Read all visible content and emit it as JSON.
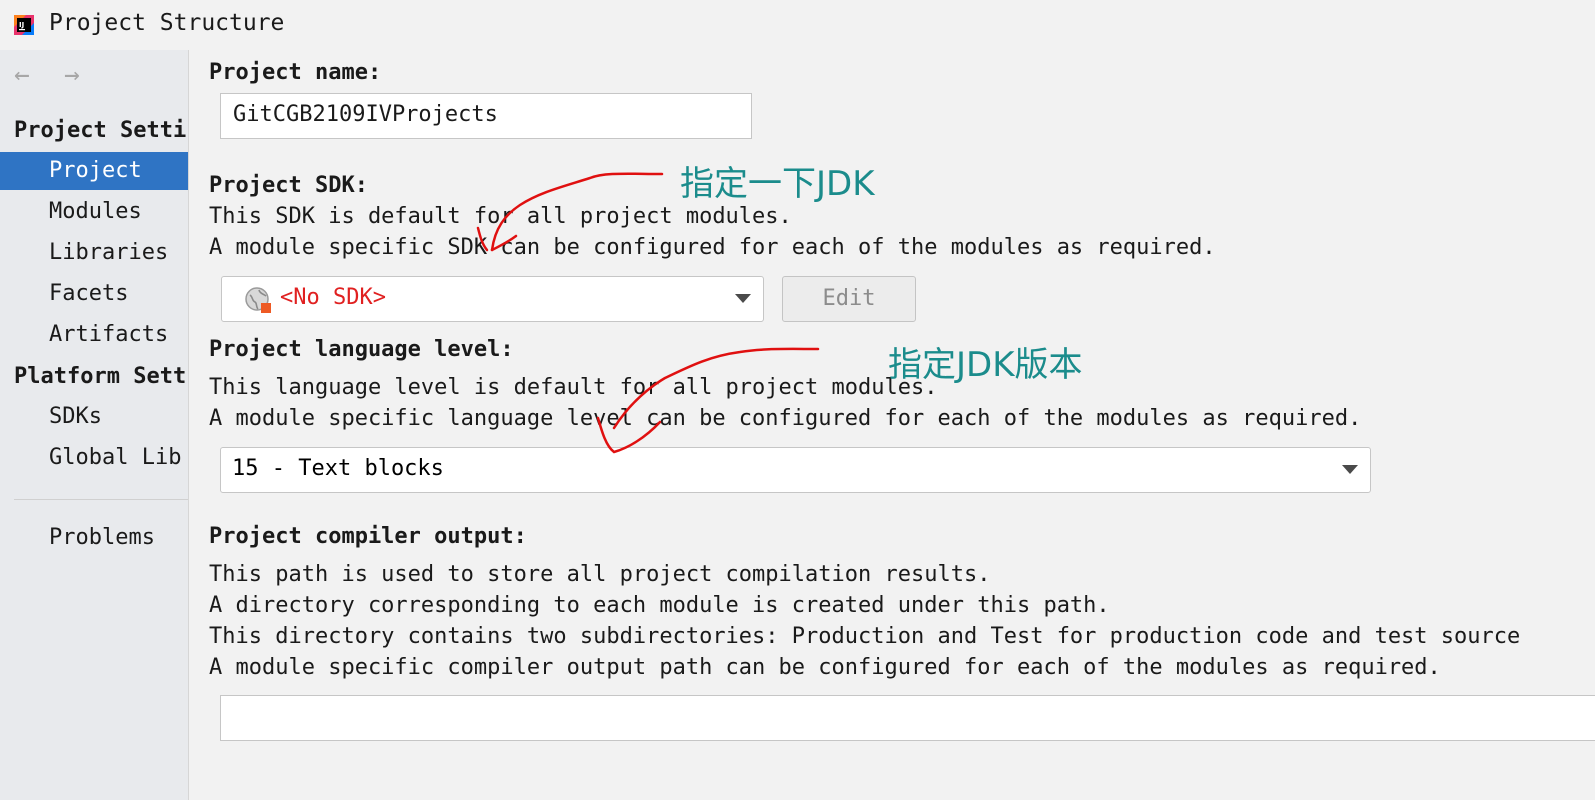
{
  "window": {
    "title": "Project Structure",
    "app_icon": "intellij-icon"
  },
  "sidebar": {
    "nav": {
      "back_icon": "arrow-left-icon",
      "back_glyph": "←",
      "forward_icon": "arrow-right-icon",
      "forward_glyph": "→"
    },
    "sections": [
      {
        "title": "Project Setti"
      },
      {
        "title": "Platform Sett"
      }
    ],
    "project_items": [
      {
        "label": "Project",
        "selected": true
      },
      {
        "label": "Modules"
      },
      {
        "label": "Libraries"
      },
      {
        "label": "Facets"
      },
      {
        "label": "Artifacts"
      }
    ],
    "platform_items": [
      {
        "label": "SDKs"
      },
      {
        "label": "Global Lib"
      }
    ],
    "problems": {
      "label": "Problems"
    }
  },
  "main": {
    "project_name": {
      "label": "Project name:",
      "value": "GitCGB2109IVProjects"
    },
    "project_sdk": {
      "label": "Project SDK:",
      "desc_line1": "This SDK is default for all project modules.",
      "desc_line2": "A module specific SDK can be configured for each of the modules as required.",
      "selected": "<No SDK>",
      "edit_button": "Edit"
    },
    "language_level": {
      "label": "Project language level:",
      "desc_line1": "This language level is default for all project modules.",
      "desc_line2": "A module specific language level can be configured for each of the modules as required.",
      "selected": "15 - Text blocks"
    },
    "compiler_output": {
      "label": "Project compiler output:",
      "desc_line1": "This path is used to store all project compilation results.",
      "desc_line2": "A directory corresponding to each module is created under this path.",
      "desc_line3": "This directory contains two subdirectories: Production and Test for production code and test source",
      "desc_line4": "A module specific compiler output path can be configured for each of the modules as required.",
      "value": ""
    }
  },
  "annotations": {
    "sdk_note": "指定一下JDK",
    "level_note": "指定JDK版本",
    "color": "#1b8c8c",
    "stroke_color": "#e01010"
  },
  "colors": {
    "selection": "#2f74c4",
    "error_text": "#e02020",
    "background": "#f2f2f2",
    "sidebar_bg": "#e8eaed"
  }
}
